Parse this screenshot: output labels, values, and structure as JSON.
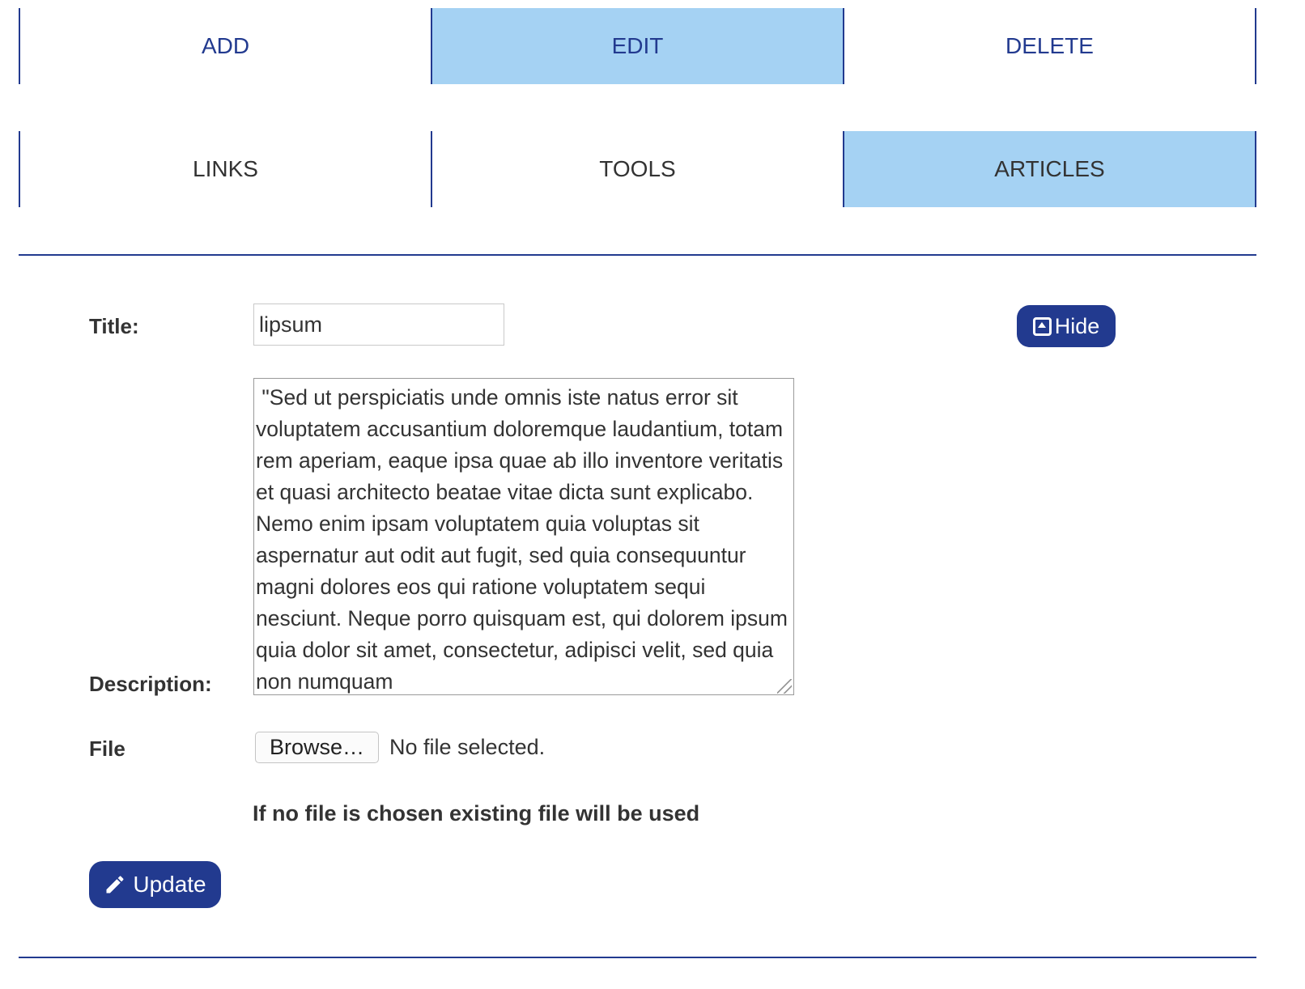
{
  "nav": {
    "actions": [
      {
        "label": "ADD",
        "active": false
      },
      {
        "label": "EDIT",
        "active": true
      },
      {
        "label": "DELETE",
        "active": false
      }
    ],
    "sections": [
      {
        "label": "LINKS",
        "active": false
      },
      {
        "label": "TOOLS",
        "active": false
      },
      {
        "label": "ARTICLES",
        "active": true
      }
    ]
  },
  "form": {
    "title_label": "Title:",
    "title_value": "lipsum",
    "hide_button": "Hide",
    "description_label": "Description:",
    "description_value": " \"Sed ut perspiciatis unde omnis iste natus error sit voluptatem accusantium doloremque laudantium, totam rem aperiam, eaque ipsa quae ab illo inventore veritatis et quasi architecto beatae vitae dicta sunt explicabo. Nemo enim ipsam voluptatem quia voluptas sit aspernatur aut odit aut fugit, sed quia consequuntur magni dolores eos qui ratione voluptatem sequi nesciunt. Neque porro quisquam est, qui dolorem ipsum quia dolor sit amet, consectetur, adipisci velit, sed quia non numquam",
    "file_label": "File",
    "browse_button": "Browse…",
    "file_status": "No file selected.",
    "file_note": "If no file is chosen existing file will be used",
    "update_button": "Update"
  },
  "colors": {
    "brand": "#223a8f",
    "active_tab": "#a5d2f3"
  }
}
